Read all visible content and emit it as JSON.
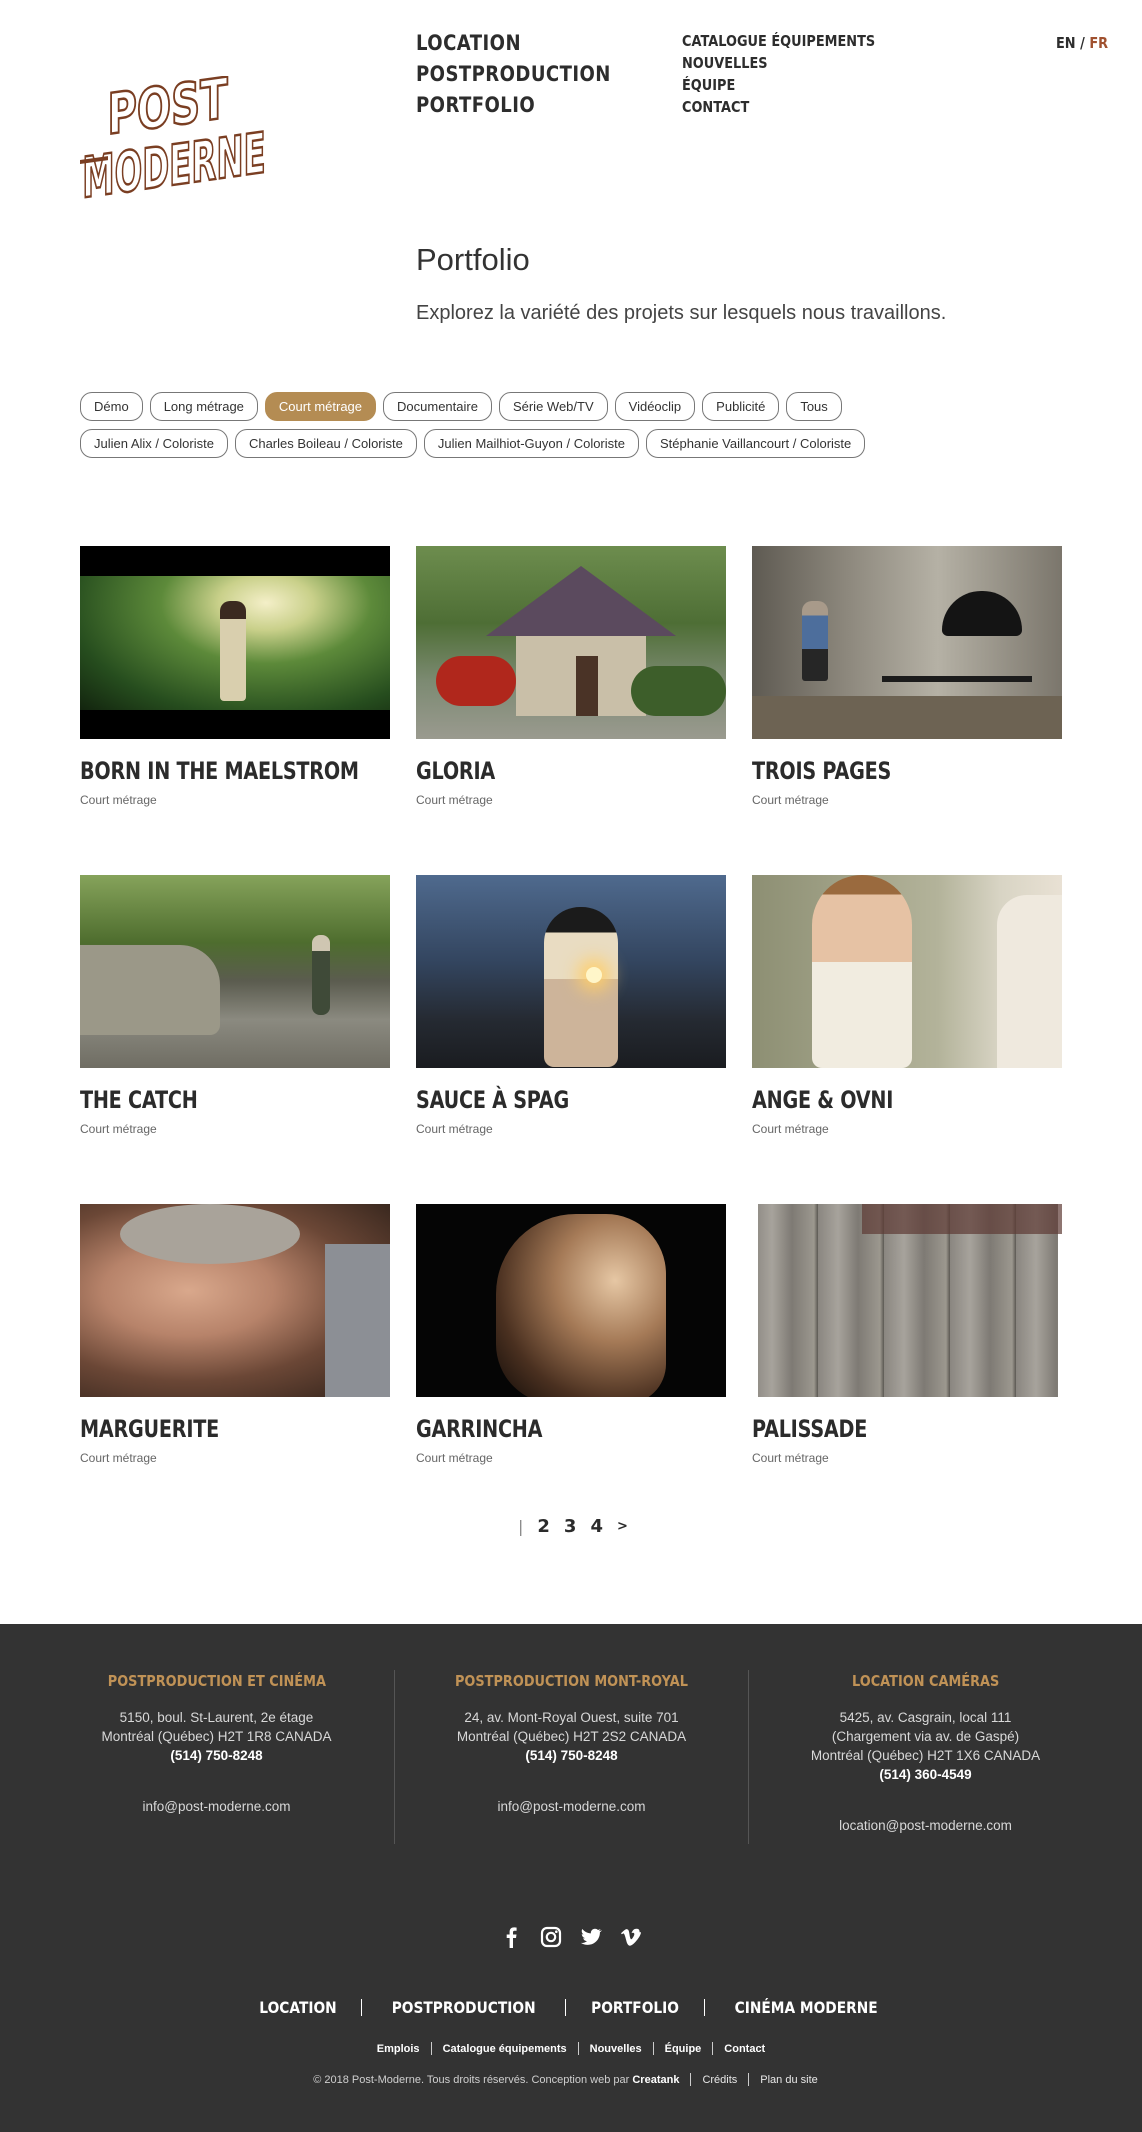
{
  "logo": {
    "line1": "POST",
    "line2": "MODERNE"
  },
  "main_nav": [
    "LOCATION",
    "POSTPRODUCTION",
    "PORTFOLIO"
  ],
  "secondary_nav": [
    "CATALOGUE ÉQUIPEMENTS",
    "NOUVELLES",
    "ÉQUIPE",
    "CONTACT"
  ],
  "lang": {
    "en": "EN",
    "sep": "/",
    "fr": "FR",
    "active": "FR"
  },
  "page": {
    "title": "Portfolio",
    "intro": "Explorez la variété des projets sur lesquels nous travaillons."
  },
  "filters": {
    "row1": [
      "Démo",
      "Long métrage",
      "Court métrage",
      "Documentaire",
      "Série Web/TV",
      "Vidéoclip",
      "Publicité",
      "Tous"
    ],
    "row2": [
      "Julien Alix / Coloriste",
      "Charles Boileau / Coloriste",
      "Julien Mailhiot-Guyon / Coloriste",
      "Stéphanie Vaillancourt / Coloriste"
    ],
    "active": "Court métrage"
  },
  "projects": [
    {
      "title": "BORN IN THE MAELSTROM",
      "category": "Court métrage",
      "thumb": "forest-woman"
    },
    {
      "title": "GLORIA",
      "category": "Court métrage",
      "thumb": "house"
    },
    {
      "title": "TROIS PAGES",
      "category": "Court métrage",
      "thumb": "piano-room"
    },
    {
      "title": "THE CATCH",
      "category": "Court métrage",
      "thumb": "river-fisher"
    },
    {
      "title": "SAUCE À SPAG",
      "category": "Court métrage",
      "thumb": "sparkler-girl"
    },
    {
      "title": "ANGE & OVNI",
      "category": "Court métrage",
      "thumb": "girl-braids"
    },
    {
      "title": "MARGUERITE",
      "category": "Court métrage",
      "thumb": "old-woman"
    },
    {
      "title": "GARRINCHA",
      "category": "Court métrage",
      "thumb": "man-profile"
    },
    {
      "title": "PALISSADE",
      "category": "Court métrage",
      "thumb": "wooden-fence"
    }
  ],
  "pagination": {
    "current_marker": "|",
    "pages": [
      "2",
      "3",
      "4"
    ],
    "next": ">"
  },
  "footer": {
    "columns": [
      {
        "title": "POSTPRODUCTION ET CINÉMA",
        "lines": [
          "5150, boul. St-Laurent, 2e étage",
          "Montréal (Québec) H2T 1R8 CANADA"
        ],
        "phone": "(514) 750-8248",
        "email": "info@post-moderne.com"
      },
      {
        "title": "POSTPRODUCTION MONT-ROYAL",
        "lines": [
          "24, av. Mont-Royal Ouest, suite 701",
          "Montréal (Québec) H2T 2S2 CANADA"
        ],
        "phone": "(514) 750-8248",
        "email": "info@post-moderne.com"
      },
      {
        "title": "LOCATION CAMÉRAS",
        "lines": [
          "5425, av. Casgrain, local 111",
          "(Chargement via av. de Gaspé)",
          "Montréal (Québec) H2T 1X6 CANADA"
        ],
        "phone": "(514) 360-4549",
        "email": "location@post-moderne.com"
      }
    ],
    "social": [
      "facebook-icon",
      "instagram-icon",
      "twitter-icon",
      "vimeo-icon"
    ],
    "nav": [
      "LOCATION",
      "POSTPRODUCTION",
      "PORTFOLIO",
      "CINÉMA MODERNE"
    ],
    "nav2": [
      "Emplois",
      "Catalogue équipements",
      "Nouvelles",
      "Équipe",
      "Contact"
    ],
    "copyright": "© 2018 Post-Moderne. Tous droits réservés. Conception web par",
    "designer": "Creatank",
    "legal": [
      "Crédits",
      "Plan du site"
    ]
  },
  "colors": {
    "accent": "#a0512f",
    "chip_active": "#b48c53",
    "footer_bg": "#333333",
    "footer_heading": "#c09256"
  }
}
